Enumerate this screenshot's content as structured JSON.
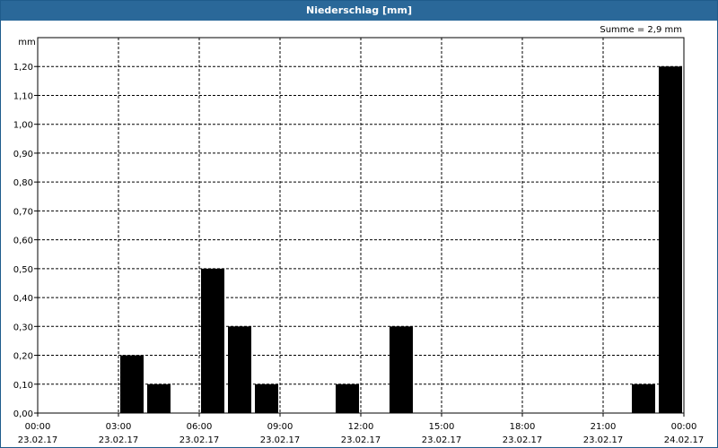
{
  "window": {
    "title": "Niederschlag [mm]"
  },
  "chart_data": {
    "type": "bar",
    "title": "Niederschlag [mm]",
    "ylabel": "mm",
    "summary": "Summe = 2,9 mm",
    "ylim": [
      0,
      1.3
    ],
    "yticks": [
      "0,00",
      "0,10",
      "0,20",
      "0,30",
      "0,40",
      "0,50",
      "0,60",
      "0,70",
      "0,80",
      "0,90",
      "1,00",
      "1,10",
      "1,20"
    ],
    "xrange_hours": [
      0,
      24
    ],
    "xticks": [
      {
        "time": "00:00",
        "date": "23.02.17"
      },
      {
        "time": "03:00",
        "date": "23.02.17"
      },
      {
        "time": "06:00",
        "date": "23.02.17"
      },
      {
        "time": "09:00",
        "date": "23.02.17"
      },
      {
        "time": "12:00",
        "date": "23.02.17"
      },
      {
        "time": "15:00",
        "date": "23.02.17"
      },
      {
        "time": "18:00",
        "date": "23.02.17"
      },
      {
        "time": "21:00",
        "date": "23.02.17"
      },
      {
        "time": "00:00",
        "date": "24.02.17"
      }
    ],
    "bars": [
      {
        "start": "03:00",
        "value": 0.2
      },
      {
        "start": "04:00",
        "value": 0.1
      },
      {
        "start": "06:00",
        "value": 0.5
      },
      {
        "start": "07:00",
        "value": 0.3
      },
      {
        "start": "08:00",
        "value": 0.1
      },
      {
        "start": "11:00",
        "value": 0.1
      },
      {
        "start": "13:00",
        "value": 0.3
      },
      {
        "start": "22:00",
        "value": 0.1
      },
      {
        "start": "23:00",
        "value": 1.2
      }
    ],
    "grid": true,
    "colors": {
      "bar": "#000000",
      "grid": "#000000",
      "title_bg": "#2a6899"
    }
  }
}
